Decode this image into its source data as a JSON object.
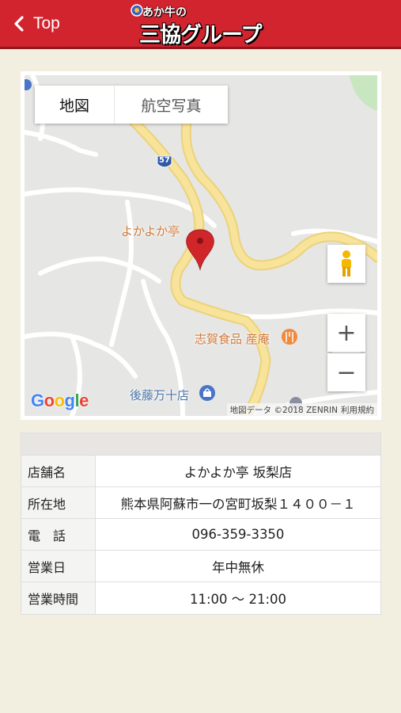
{
  "header": {
    "back_label": "Top",
    "logo_top": "あか牛の",
    "logo_main": "三協グループ"
  },
  "map": {
    "type_map": "地図",
    "type_satellite": "航空写真",
    "zoom_in": "+",
    "zoom_out": "−",
    "route_number": "57",
    "marker_label": "よかよか亭",
    "poi_food": "志賀食品 産庵",
    "poi_shop": "後藤万十店",
    "attribution": "地図データ ©2018 ZENRIN",
    "terms": "利用規約",
    "google_logo": "Google"
  },
  "info": {
    "rows": [
      {
        "key": "店舗名",
        "value": "よかよか亭 坂梨店"
      },
      {
        "key": "所在地",
        "value": "熊本県阿蘇市一の宮町坂梨１４００－１"
      },
      {
        "key": "電　話",
        "value": "096-359-3350"
      },
      {
        "key": "営業日",
        "value": "年中無休"
      },
      {
        "key": "営業時間",
        "value": "11:00 〜 21:00"
      }
    ]
  },
  "colors": {
    "header": "#d1242f",
    "background": "#f3efe0",
    "road": "#f5dd85",
    "marker": "#d0262a"
  }
}
